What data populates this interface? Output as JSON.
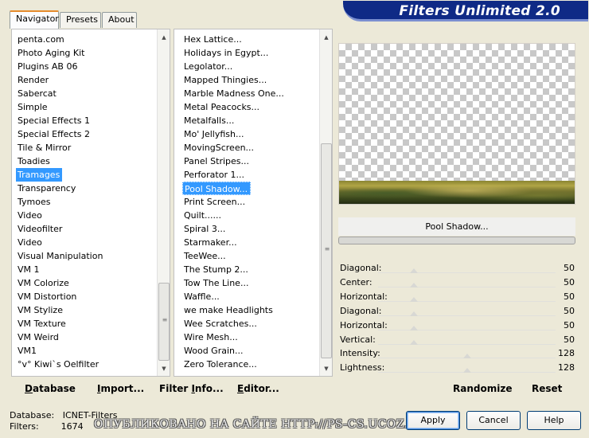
{
  "tabs": [
    {
      "label": "Navigator",
      "active": true
    },
    {
      "label": "Presets",
      "active": false
    },
    {
      "label": "About",
      "active": false
    }
  ],
  "app_title": "Filters Unlimited 2.0",
  "categories": {
    "items": [
      "penta.com",
      "Photo Aging Kit",
      "Plugins AB 06",
      "Render",
      "Sabercat",
      "Simple",
      "Special Effects 1",
      "Special Effects 2",
      "Tile & Mirror",
      "Toadies",
      "Tramages",
      "Transparency",
      "Tymoes",
      "Video",
      "Videofilter",
      "Video",
      "Visual Manipulation",
      "VM 1",
      "VM Colorize",
      "VM Distortion",
      "VM Stylize",
      "VM Texture",
      "VM Weird",
      "VM1",
      "°v° Kiwi`s Oelfilter"
    ],
    "selected": "Tramages"
  },
  "filters": {
    "items": [
      "Hex Lattice...",
      "Holidays in Egypt...",
      "Legolator...",
      "Mapped Thingies...",
      "Marble Madness One...",
      "Metal Peacocks...",
      "Metalfalls...",
      "Mo' Jellyfish...",
      "MovingScreen...",
      "Panel Stripes...",
      "Perforator 1...",
      "Pool Shadow...",
      "Print Screen...",
      "Quilt......",
      "Spiral 3...",
      "Starmaker...",
      "TeeWee...",
      "The Stump 2...",
      "Tow The Line...",
      "Waffle...",
      "we make Headlights",
      "Wee Scratches...",
      "Wire Mesh...",
      "Wood Grain...",
      "Zero Tolerance..."
    ],
    "selected": "Pool Shadow..."
  },
  "bottom_buttons": {
    "database": "Database",
    "import": "Import...",
    "filter_info": "Filter Info...",
    "editor": "Editor..."
  },
  "preview": {
    "filter_name": "Pool Shadow..."
  },
  "params": [
    {
      "label": "Diagonal:",
      "value": "50",
      "level": 0.2
    },
    {
      "label": "Center:",
      "value": "50",
      "level": 0.2
    },
    {
      "label": "Horizontal:",
      "value": "50",
      "level": 0.2
    },
    {
      "label": "Diagonal:",
      "value": "50",
      "level": 0.2
    },
    {
      "label": "Horizontal:",
      "value": "50",
      "level": 0.2
    },
    {
      "label": "Vertical:",
      "value": "50",
      "level": 0.2
    },
    {
      "label": "Intensity:",
      "value": "128",
      "level": 0.5
    },
    {
      "label": "Lightness:",
      "value": "128",
      "level": 0.5
    }
  ],
  "randomize_label": "Randomize",
  "reset_label": "Reset",
  "status": {
    "database_label": "Database:",
    "database_value": "ICNET-Filters",
    "filters_label": "Filters:",
    "filters_value": "1674"
  },
  "watermark": "ОПУБЛИКОВАНО  НА САЙТЕ  HTTP://PS-CS.UCOZ.RU",
  "dialog_buttons": {
    "apply": "Apply",
    "cancel": "Cancel",
    "help": "Help"
  },
  "colors": {
    "selection": "#3399ff",
    "title_banner": "#0f2a86",
    "window_bg": "#ece9d8"
  }
}
